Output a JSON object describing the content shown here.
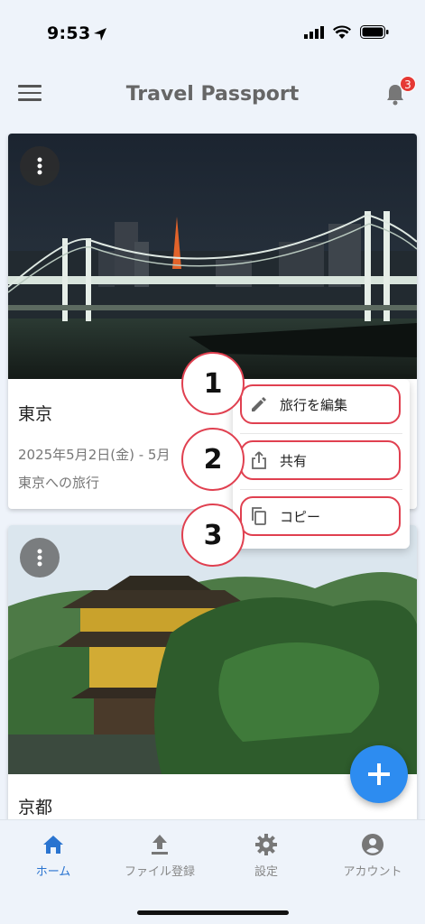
{
  "status_bar": {
    "time": "9:53"
  },
  "app": {
    "title": "Travel Passport",
    "notification_count": "3"
  },
  "trips": [
    {
      "title": "東京",
      "dates": "2025年5月2日(金) - 5月",
      "description": "東京への旅行"
    },
    {
      "title": "京都"
    }
  ],
  "context_menu": {
    "items": [
      {
        "label": "旅行を編集",
        "icon": "pencil-icon"
      },
      {
        "label": "共有",
        "icon": "share-icon"
      },
      {
        "label": "コピー",
        "icon": "copy-icon"
      }
    ]
  },
  "callouts": [
    "1",
    "2",
    "3"
  ],
  "bottom_nav": {
    "items": [
      {
        "label": "ホーム",
        "icon": "home-icon",
        "active": true
      },
      {
        "label": "ファイル登録",
        "icon": "upload-icon",
        "active": false
      },
      {
        "label": "設定",
        "icon": "gear-icon",
        "active": false
      },
      {
        "label": "アカウント",
        "icon": "account-icon",
        "active": false
      }
    ]
  },
  "colors": {
    "accent": "#2d8cf0",
    "active_nav": "#2a74d0",
    "badge": "#e53935",
    "highlight_border": "#e04050"
  }
}
